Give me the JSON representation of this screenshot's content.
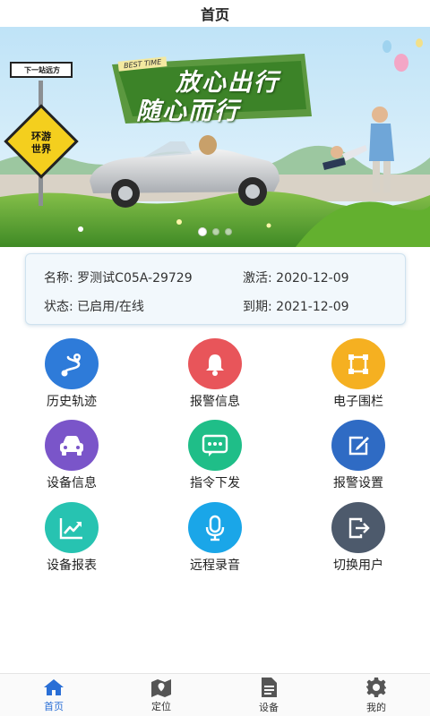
{
  "header": {
    "title": "首页"
  },
  "banner": {
    "sign_direction": "下一站远方",
    "sign_diamond_line1": "环游",
    "sign_diamond_line2": "世界",
    "ribbon": "BEST TIME",
    "slogan_line1": "放心出行",
    "slogan_line2": "随心而行",
    "page_count": 3,
    "active_page": 1
  },
  "device": {
    "name_label": "名称: ",
    "name_value": "罗测试C05A-29729",
    "activate_label": "激活: ",
    "activate_value": "2020-12-09",
    "status_label": "状态: ",
    "status_value": "已启用/在线",
    "expire_label": "到期: ",
    "expire_value": "2021-12-09"
  },
  "features": [
    {
      "label": "历史轨迹",
      "icon": "route-icon",
      "color": "#2e7bd9"
    },
    {
      "label": "报警信息",
      "icon": "bell-icon",
      "color": "#e8555a"
    },
    {
      "label": "电子围栏",
      "icon": "fence-icon",
      "color": "#f5b021"
    },
    {
      "label": "设备信息",
      "icon": "car-icon",
      "color": "#7a55c9"
    },
    {
      "label": "指令下发",
      "icon": "message-icon",
      "color": "#1fbe88"
    },
    {
      "label": "报警设置",
      "icon": "edit-icon",
      "color": "#2f6bc4"
    },
    {
      "label": "设备报表",
      "icon": "chart-icon",
      "color": "#27c3b1"
    },
    {
      "label": "远程录音",
      "icon": "microphone-icon",
      "color": "#1aa6e8"
    },
    {
      "label": "切换用户",
      "icon": "logout-icon",
      "color": "#4d5a6c"
    }
  ],
  "tabs": [
    {
      "label": "首页",
      "icon": "home-icon"
    },
    {
      "label": "定位",
      "icon": "map-icon"
    },
    {
      "label": "设备",
      "icon": "document-icon"
    },
    {
      "label": "我的",
      "icon": "gear-icon"
    }
  ],
  "colors": {
    "accent": "#2a6fd6",
    "tab_inactive": "#555555"
  }
}
